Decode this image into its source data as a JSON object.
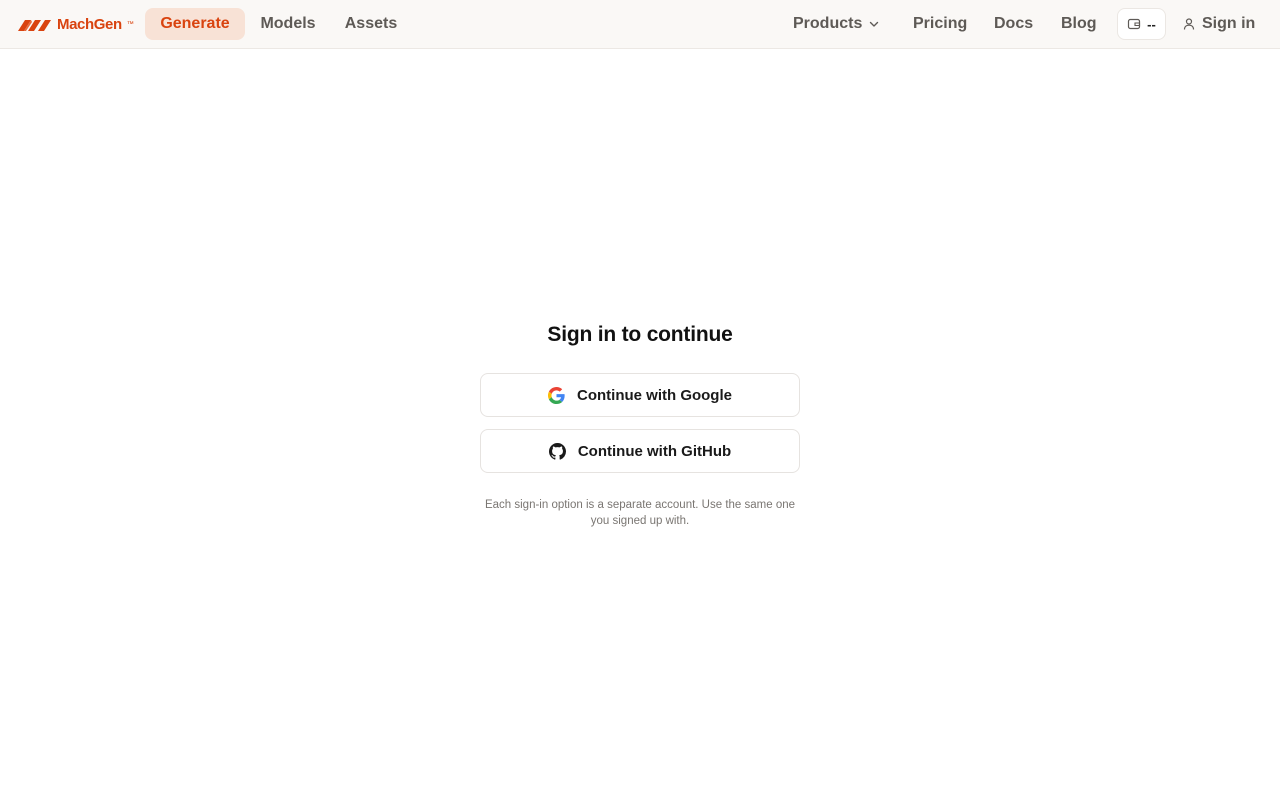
{
  "brand": {
    "name": "MachGen",
    "tm": "™",
    "color": "#d9430f"
  },
  "nav": {
    "left": [
      {
        "label": "Generate",
        "active": true
      },
      {
        "label": "Models",
        "active": false
      },
      {
        "label": "Assets",
        "active": false
      }
    ],
    "right": {
      "products": "Products",
      "pricing": "Pricing",
      "docs": "Docs",
      "blog": "Blog",
      "credits_value": "--",
      "sign_in": "Sign in"
    }
  },
  "auth": {
    "title": "Sign in to continue",
    "google_label": "Continue with Google",
    "github_label": "Continue with GitHub",
    "note": "Each sign-in option is a separate account. Use the same one you signed up with."
  },
  "icons": {
    "google": "google-icon",
    "github": "github-icon",
    "credits": "wallet-icon",
    "user": "user-icon",
    "chevron": "chevron-down-icon"
  },
  "colors": {
    "accent": "#d9430f",
    "active_tab_bg": "#f8e2d6",
    "nav_bg": "#faf8f6"
  }
}
